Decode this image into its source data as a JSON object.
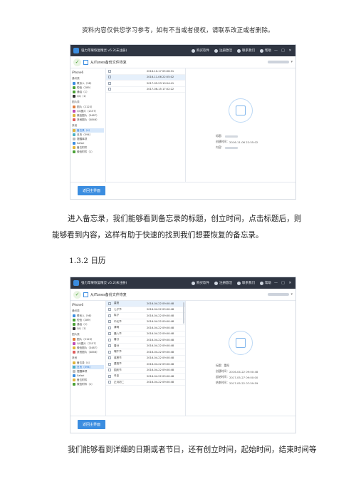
{
  "header": "资料内容仅供您学习参考，如有不当或者侵权，请联系改正或者删除。",
  "app": {
    "title": "强力苹果恢复精灵 v5.2(未注册)",
    "links": [
      "购买软件",
      "注册激活",
      "联系我们",
      "帮助"
    ],
    "win_min": "—",
    "win_max": "□",
    "win_close": "✕",
    "subtitle": "从iTunes备份文件恢复",
    "check": "✓",
    "caret": "▾",
    "back_button": "返回主界面"
  },
  "sidebar": {
    "device": "iPhone6",
    "groups": [
      "通讯类",
      "图片类",
      "其他"
    ],
    "comm_items": [
      "联系人（98）",
      "短信（289）",
      "通话（1）",
      "QQ（1）"
    ],
    "pic_items": [
      "图片（2123）",
      "QQ图片（2157）",
      "微信图片（3487）",
      "其他图片（4846）"
    ],
    "other_items_1": [
      "备忘录（4）",
      "日历（594）",
      "提醒事项",
      "Safari",
      "备忘附件",
      "微信附件（1）"
    ],
    "other_items_2": [
      "备忘录（4）",
      "日历（594）",
      "提醒事项",
      "Safari",
      "备忘附件",
      "微信附件（1）"
    ],
    "colors": [
      "#3b8de0",
      "#4aa136",
      "#e07b3b",
      "#c04bb5",
      "#e0b43b",
      "#4ab0c4"
    ]
  },
  "memo": {
    "rows": [
      {
        "date": "2016-10-17 05:06:31"
      },
      {
        "date": "2016-11-06 22:55:02"
      },
      {
        "date": "2017-05-23 10:54:41"
      },
      {
        "date": "2017-06-15 17:02:22"
      }
    ],
    "title_label": "标题：",
    "created_label": "创建时间：",
    "created_value": "2016-11-06 22:55:02",
    "content_label": "内容："
  },
  "calendar": {
    "rows": [
      {
        "title": "重阳",
        "date": "2016-04-22 09:00:48"
      },
      {
        "title": "七夕节",
        "date": "2016-04-22 09:00:48"
      },
      {
        "title": "除夕",
        "date": "2016-04-22 09:00:48"
      },
      {
        "title": "中元节",
        "date": "2016-04-22 09:00:48"
      },
      {
        "title": "清明",
        "date": "2016-04-22 09:00:48"
      },
      {
        "title": "腊八节",
        "date": "2016-04-22 09:00:48"
      },
      {
        "title": "春分",
        "date": "2016-04-22 09:00:48"
      },
      {
        "title": "春分",
        "date": "2016-04-22 09:00:48"
      },
      {
        "title": "端午节",
        "date": "2016-04-22 09:00:48"
      },
      {
        "title": "感恩节",
        "date": "2016-04-22 09:00:48"
      },
      {
        "title": "重阳节",
        "date": "2016-04-22 09:00:48"
      },
      {
        "title": "国庆节",
        "date": "2016-04-22 09:00:48"
      },
      {
        "title": "冬至",
        "date": "2016-04-22 09:00:48"
      },
      {
        "title": "正月初二",
        "date": "2016-04-22 09:00:48"
      }
    ],
    "title_label": "标题：",
    "title_value": "重阳",
    "created_label": "创建时间：",
    "created_value": "2016-04-22 09:00:48",
    "start_label": "起始时间：",
    "start_value": "2017-05-27 09:00:00",
    "end_label": "结束时间：",
    "end_value": "2017-05-22 07:59:59"
  },
  "text": {
    "p1": "进入备忘录，我们能够看到备忘录的标题，创立时间，点击标题后，则能够看到内容，这样有助于快速的找到我们想要恢复的备忘录。",
    "heading": "1.3.2 日历",
    "p3": "我们能够看到详细的日期或者节日，还有创立时间，起始时间，结束时间等"
  }
}
